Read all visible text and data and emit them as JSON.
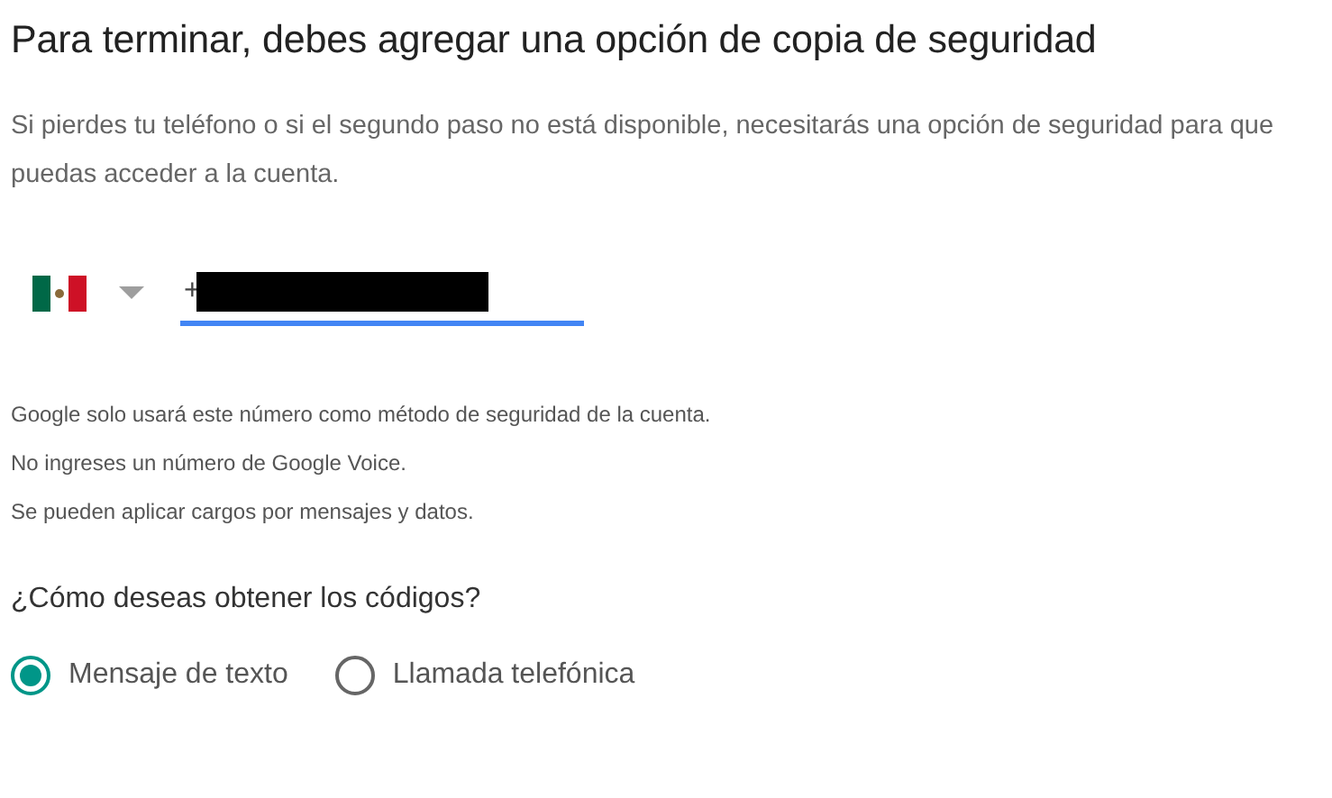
{
  "heading": "Para terminar, debes agregar una opción de copia de seguridad",
  "intro": "Si pierdes tu teléfono o si el segundo paso no está disponible, necesitarás una opción de seguridad para que puedas acceder a la cuenta.",
  "phone": {
    "value": "+",
    "redacted": true,
    "focused": true
  },
  "notes": [
    "Google solo usará este número como método de seguridad de la cuenta.",
    "No ingreses un número de Google Voice.",
    "Se pueden aplicar cargos por mensajes y datos."
  ],
  "question": "¿Cómo deseas obtener los códigos?",
  "options": [
    {
      "label": "Mensaje de texto",
      "selected": true
    },
    {
      "label": "Llamada telefónica",
      "selected": false
    }
  ]
}
